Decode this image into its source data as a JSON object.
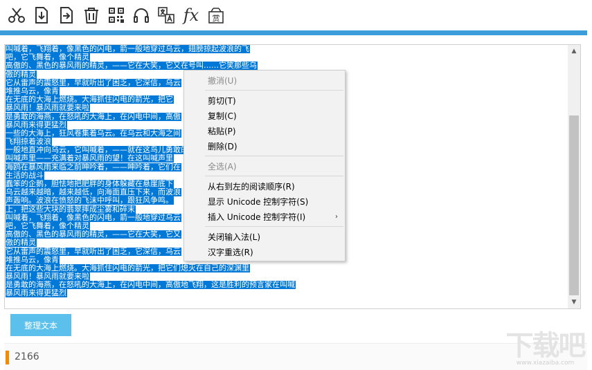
{
  "toolbar": {
    "buttons": [
      "cut-icon",
      "import-icon",
      "export-icon",
      "delete-icon",
      "qrcode-icon",
      "headphones-icon",
      "translate-icon",
      "fx-icon",
      "reward-icon"
    ],
    "fx_label": "fx",
    "reward_label": "赏"
  },
  "editor": {
    "lines": [
      "叫喊着，飞翔着，像黑色的闪电，箭一般地穿过乌云，翅膀掠起波浪的飞",
      "吧，它飞舞着，像个精灵",
      "高傲的、黑色的暴风雨的精灵，——它在大笑，它又在号叫……它笑那些乌",
      "傲的精灵",
      "它从雷声的震怒里，早就听出了困乏，它深信，乌云",
      "堆推乌云，像青",
      "在无底的大海上燃烧。大海抓住闪电的箭光，把它",
      "暴风雨！暴风雨就要来啦",
      "是勇敢的海燕，在怒吼的大海上，在闪电中间，高傲",
      "暴风雨来得更猛烈",
      "一些的大海上，狂风卷集着乌云。在乌云和大海之间",
      "飞翔掠着波浪",
      "一般地直冲向乌云，它叫喊着，——就在这鸟儿勇敢的",
      "叫喊声里——充满着对暴风雨的望！在这叫喊声里",
      "海鸥在暴风雨来临之前呻吟着，——呻吟着，它们在",
      "生活的战斗",
      "蠢笨的企鹅，胆怯地把肥胖的身体躲藏在悬崖底下",
      "乌云越来越暗，越来越低，向海面直压下来，而波浪",
      "声轰响。波浪在愤怒的飞沫中呼叫，跟狂风争鸣。",
      "上，把这些大块的翡翠摔成尘雾和碎末",
      "叫喊着，飞翔着，像黑色的闪电，箭一般地穿过乌云",
      "吧，它飞舞着，像个精灵",
      "高傲的、黑色的暴风雨的精灵，——它在大笑，它又",
      "傲的精灵",
      "它从雷声的震怒里，早就听出了困乏，它深信，乌云",
      "堆推乌云，像青",
      "在无底的大海上燃烧。大海抓住闪电的箭光，把它们熄灭在自己的深渊里",
      "暴风雨！暴风雨就要来啦",
      "是勇敢的海燕，在怒吼的大海上，在闪电中间，高傲地飞翔，这是胜利的预言家在叫喊",
      "暴风雨来得更猛烈"
    ],
    "scroll_up": "▲",
    "scroll_down": "▼"
  },
  "context_menu": {
    "items": [
      {
        "label": "撤消(U)",
        "enabled": false
      },
      {
        "label": "剪切(T)",
        "enabled": true
      },
      {
        "label": "复制(C)",
        "enabled": true
      },
      {
        "label": "粘贴(P)",
        "enabled": true
      },
      {
        "label": "删除(D)",
        "enabled": true
      },
      {
        "label": "全选(A)",
        "enabled": false
      },
      {
        "label": "从右到左的阅读顺序(R)",
        "enabled": true
      },
      {
        "label": "显示 Unicode 控制字符(S)",
        "enabled": true
      },
      {
        "label": "插入 Unicode 控制字符(I)",
        "enabled": true,
        "submenu_arrow": "›"
      },
      {
        "label": "关闭输入法(L)",
        "enabled": true
      },
      {
        "label": "汉字重选(R)",
        "enabled": true
      }
    ]
  },
  "actions": {
    "tidy_label": "整理文本"
  },
  "status": {
    "char_count": "2166"
  },
  "watermark": {
    "text": "下载吧",
    "url": "www.xiazaiba.com"
  },
  "colors": {
    "accent_blue": "#3c9fdc",
    "selection": "#0078d7",
    "button": "#5bc0eb",
    "status_accent": "#f28b00"
  }
}
